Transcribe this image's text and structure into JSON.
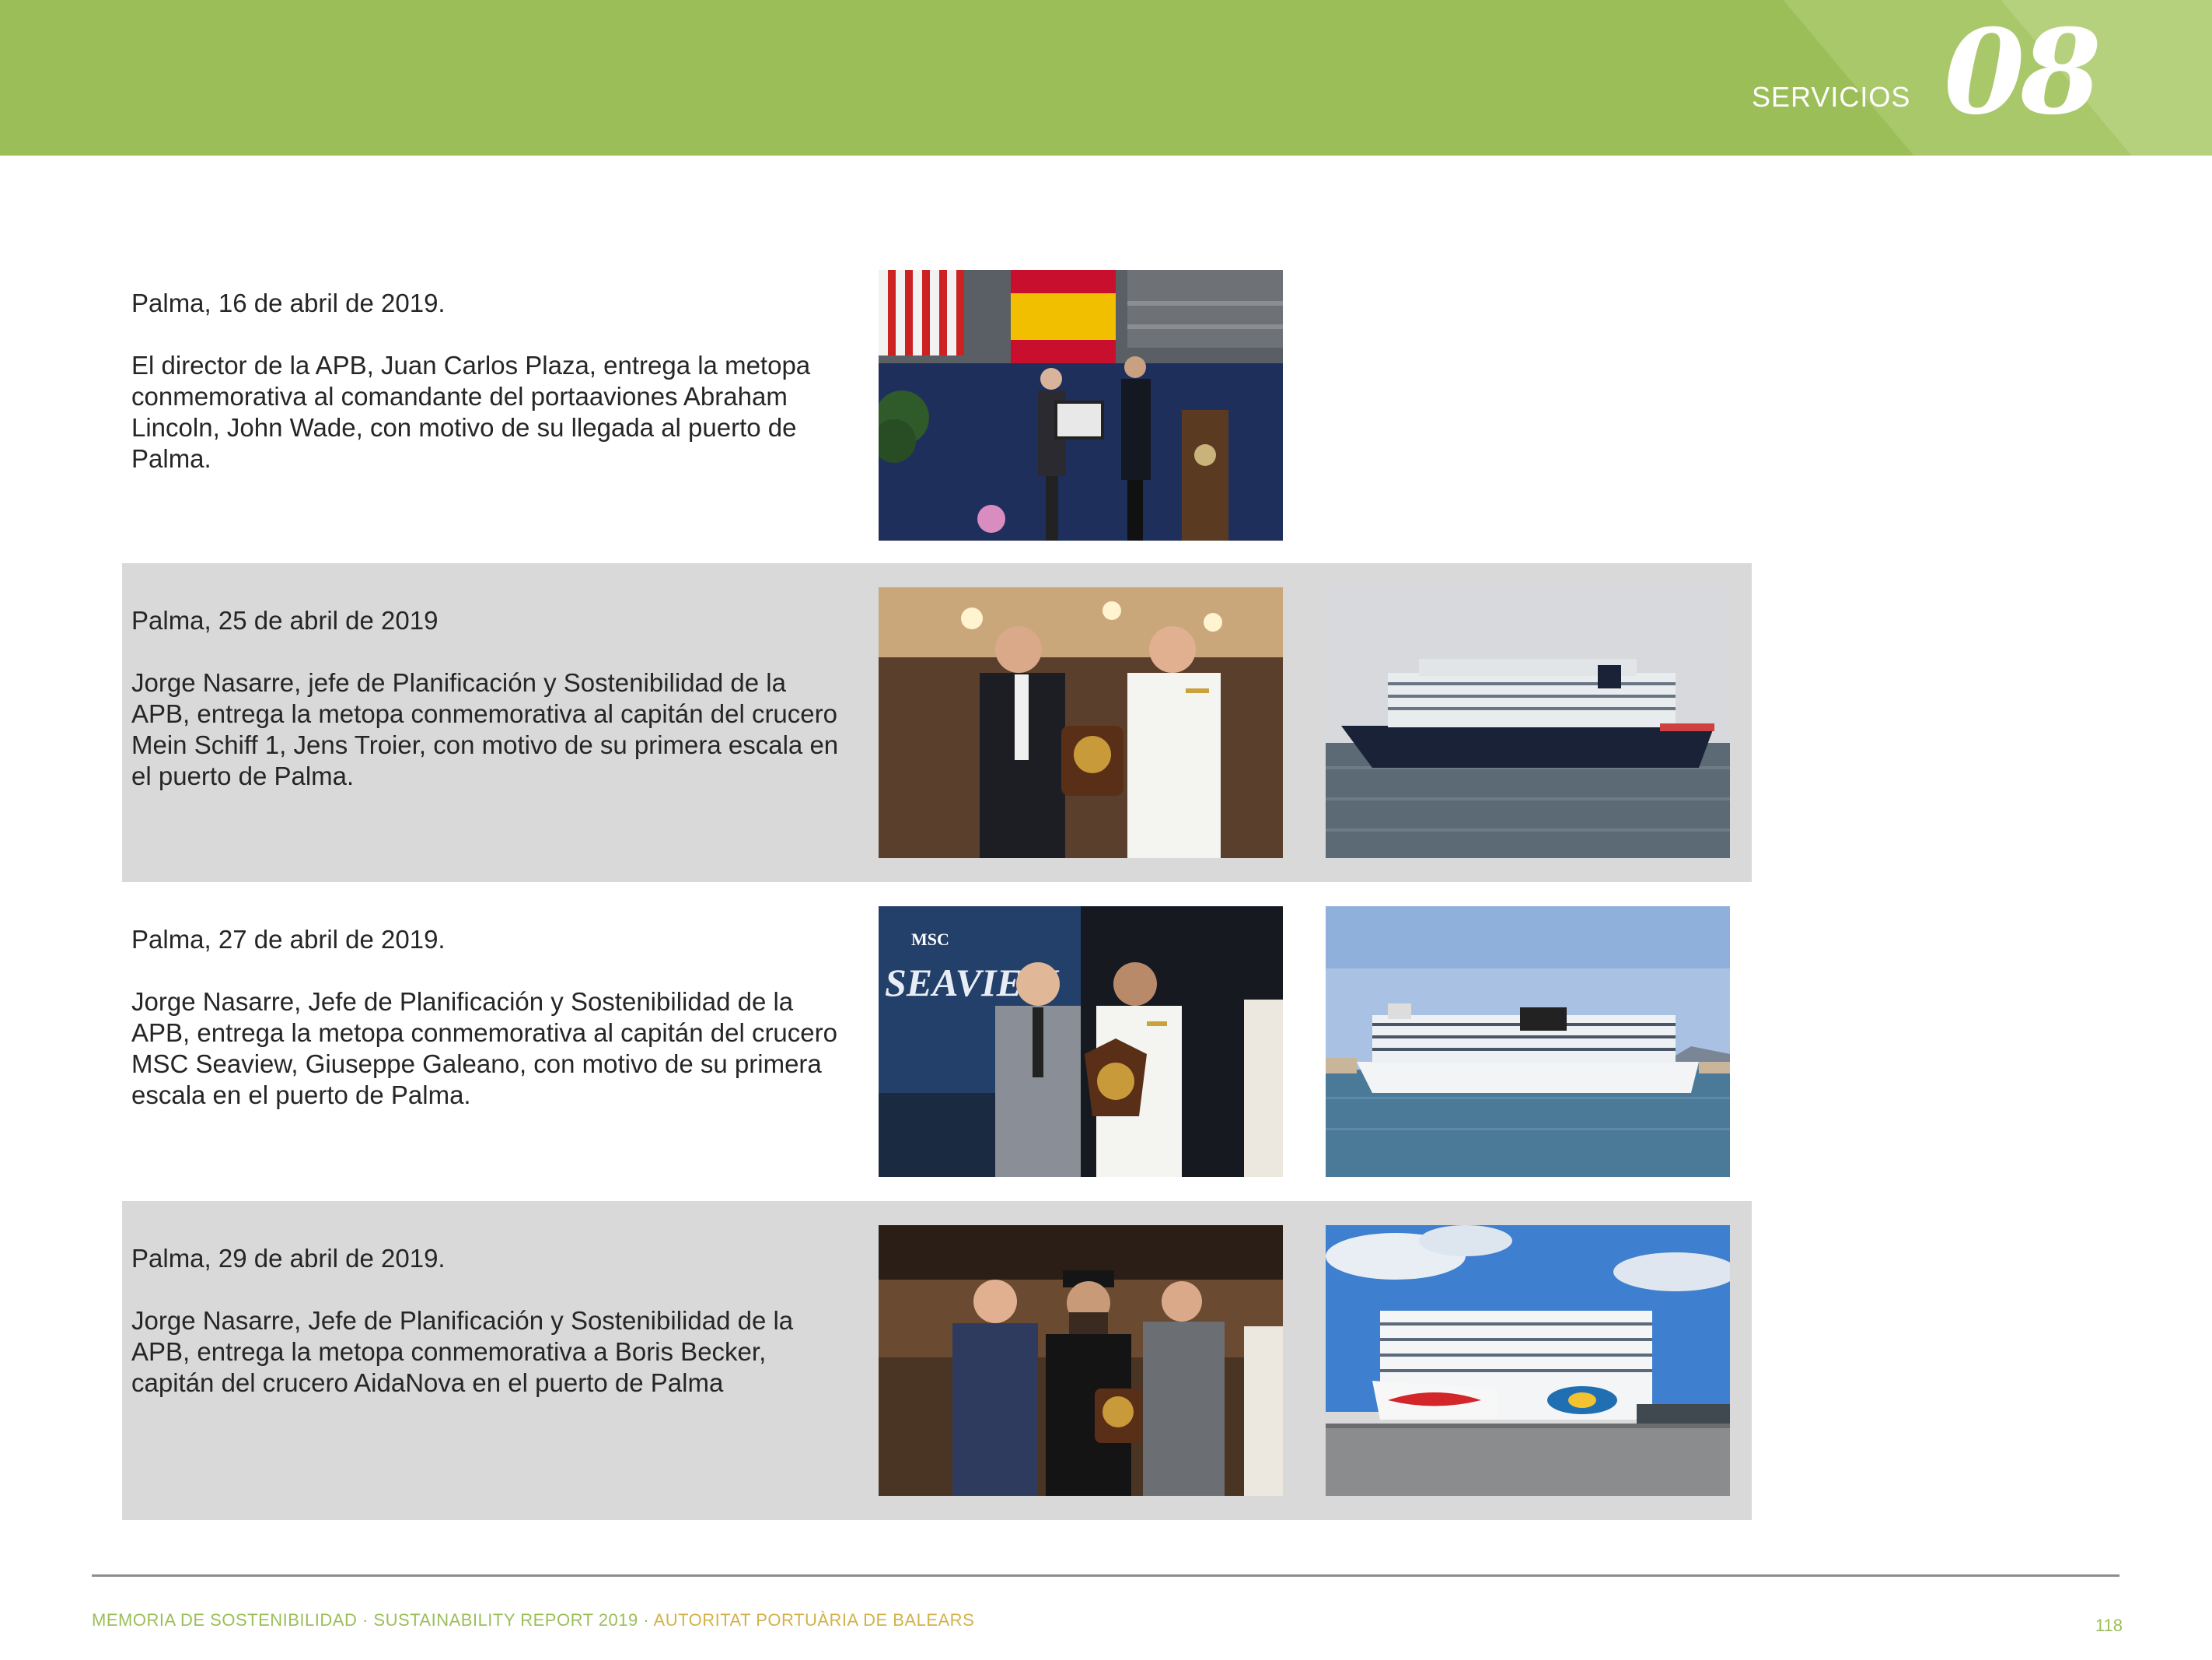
{
  "header": {
    "section_label": "SERVICIOS",
    "section_number": "08",
    "band_color": "#9bbe58"
  },
  "entries": [
    {
      "date": "Palma, 16 de abril de 2019.",
      "description": "El director de la APB, Juan Carlos Plaza, entrega la metopa conmemorativa al comandante del portaaviones Abraham Lincoln, John Wade, con motivo de su llegada al puerto de Palma.",
      "shaded": false,
      "photos": [
        "ceremony-aircraft-carrier-photo"
      ]
    },
    {
      "date": "Palma, 25 de abril de 2019",
      "description": "Jorge Nasarre, jefe de Planificación y Sostenibilidad de la APB, entrega la metopa conmemorativa al capitán del crucero Mein Schiff 1, Jens Troier, con motivo de su primera escala en el puerto de Palma.",
      "shaded": true,
      "photos": [
        "plaque-handover-photo",
        "mein-schiff-ship-photo"
      ]
    },
    {
      "date": "Palma, 27 de abril de 2019.",
      "description": "Jorge Nasarre, Jefe de Planificación y Sostenibilidad de la APB, entrega la metopa conmemorativa al capitán del crucero MSC Seaview, Giuseppe Galeano, con motivo de su primera escala en el puerto de Palma.",
      "shaded": false,
      "photos": [
        "plaque-handover-photo",
        "msc-seaview-ship-photo"
      ]
    },
    {
      "date": "Palma, 29 de abril de 2019.",
      "description": "Jorge Nasarre, Jefe de Planificación y Sostenibilidad de la APB, entrega la metopa conmemorativa a Boris Becker, capitán del crucero AidaNova en el puerto de Palma",
      "shaded": true,
      "photos": [
        "plaque-handover-photo",
        "aidanova-ship-photo"
      ]
    }
  ],
  "photo_text": {
    "msc_logo": "MSC",
    "seaview_banner": "SEAVIEW"
  },
  "footer": {
    "report_title": "MEMORIA DE SOSTENIBILIDAD · SUSTAINABILITY REPORT 2019 · ",
    "organization": "AUTORITAT PORTUÀRIA DE BALEARS",
    "page_number": "118"
  }
}
